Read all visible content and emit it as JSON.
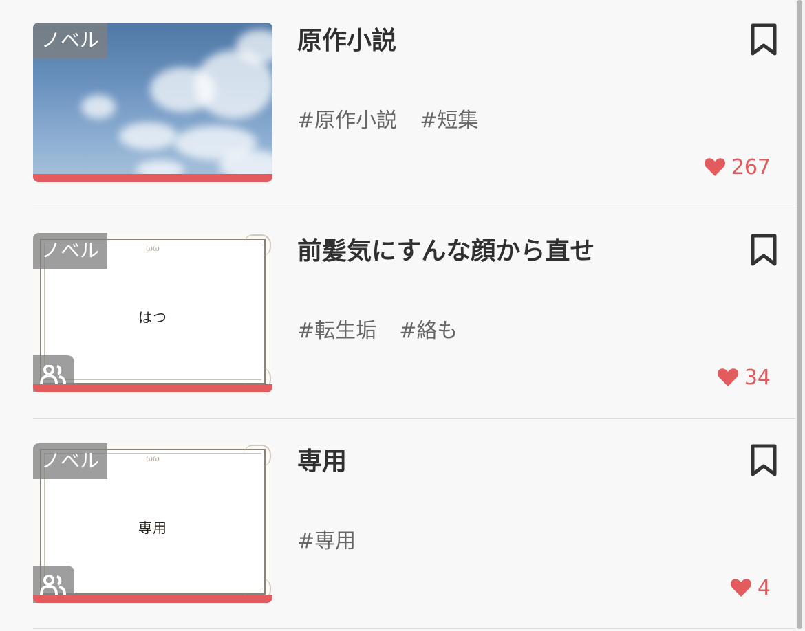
{
  "items": [
    {
      "badge": "ノベル",
      "title": "原作小説",
      "tags": [
        "#原作小説",
        "#短集"
      ],
      "likes": "267",
      "cover_text": "",
      "has_people_badge": false
    },
    {
      "badge": "ノベル",
      "title": "前髪気にすんな顔から直せ",
      "tags": [
        "#転生垢",
        "#絡も"
      ],
      "likes": "34",
      "cover_text": "はつ",
      "has_people_badge": true
    },
    {
      "badge": "ノベル",
      "title": "専用",
      "tags": [
        "#専用"
      ],
      "likes": "4",
      "cover_text": "専用",
      "has_people_badge": true
    }
  ],
  "icons": {
    "bookmark": "bookmark-icon",
    "like": "heart-icon",
    "group": "people-icon"
  },
  "colors": {
    "background": "#f8f8f8",
    "accent": "#e35b5d",
    "title": "#303030",
    "tag": "#666666",
    "badge": "#808080"
  }
}
